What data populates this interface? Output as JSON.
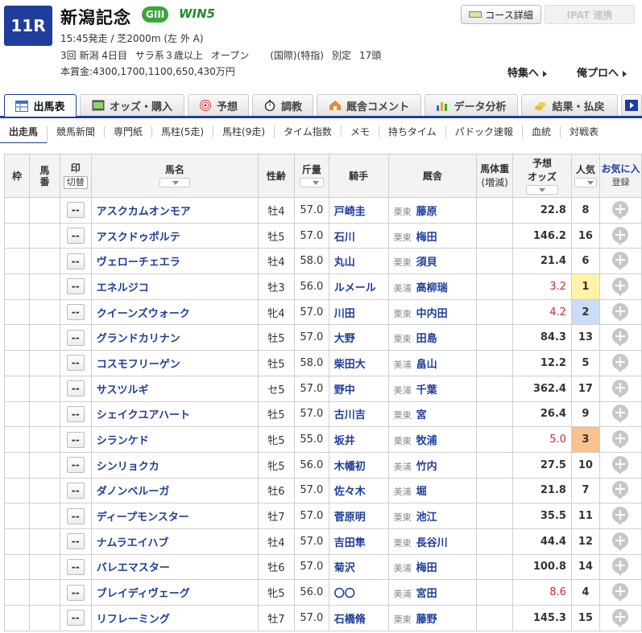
{
  "race": {
    "number": "11R",
    "name": "新潟記念",
    "grade": "GIII",
    "win5_label": "WIN5",
    "start_time": "15:45発走",
    "course": "芝2000m (左 外 A)",
    "info": [
      "3回 新潟 4日目",
      "サラ系３歳以上",
      "オープン",
      "(国際)(特指)",
      "別定",
      "17頭"
    ],
    "prize": "本賞金:4300,1700,1100,650,430万円"
  },
  "header_buttons": {
    "course_detail": "コース詳細",
    "ipat": "IPAT 連携",
    "feature": "特集へ",
    "pro": "俺プロへ"
  },
  "tabs": [
    {
      "label": "出馬表",
      "active": true
    },
    {
      "label": "オッズ・購入",
      "active": false
    },
    {
      "label": "予想",
      "active": false
    },
    {
      "label": "調教",
      "active": false
    },
    {
      "label": "厩舎コメント",
      "active": false
    },
    {
      "label": "データ分析",
      "active": false
    },
    {
      "label": "結果・払戻",
      "active": false
    }
  ],
  "subtabs": [
    "出走馬",
    "競馬新聞",
    "専門紙",
    "馬柱(5走)",
    "馬柱(9走)",
    "タイム指数",
    "メモ",
    "持ちタイム",
    "パドック速報",
    "血統",
    "対戦表"
  ],
  "columns": {
    "waku": "枠",
    "umaban": "馬番",
    "mark": "印",
    "mark_toggle": "切替",
    "horse": "馬名",
    "sexage": "性齢",
    "weight": "斤量",
    "jockey": "騎手",
    "trainer": "厩舎",
    "body_weight": "馬体重",
    "body_weight_sub": "(増減)",
    "odds": "予想",
    "odds_sub": "オッズ",
    "popularity": "人気",
    "fav": "お気に入",
    "fav_sub": "登録"
  },
  "mark_default": "--",
  "horses": [
    {
      "name": "アスクカムオンモア",
      "sexage": "牡4",
      "kg": "57.0",
      "jockey": "戸崎圭",
      "region": "栗東",
      "trainer": "藤原",
      "odds": "22.8",
      "pop": "8"
    },
    {
      "name": "アスクドゥポルテ",
      "sexage": "牡5",
      "kg": "57.0",
      "jockey": "石川",
      "region": "栗東",
      "trainer": "梅田",
      "odds": "146.2",
      "pop": "16"
    },
    {
      "name": "ヴェローチェエラ",
      "sexage": "牡4",
      "kg": "58.0",
      "jockey": "丸山",
      "region": "栗東",
      "trainer": "須貝",
      "odds": "21.4",
      "pop": "6"
    },
    {
      "name": "エネルジコ",
      "sexage": "牡3",
      "kg": "56.0",
      "jockey": "ルメール",
      "region": "美浦",
      "trainer": "高柳瑞",
      "odds": "3.2",
      "pop": "1"
    },
    {
      "name": "クイーンズウォーク",
      "sexage": "牝4",
      "kg": "57.0",
      "jockey": "川田",
      "region": "栗東",
      "trainer": "中内田",
      "odds": "4.2",
      "pop": "2"
    },
    {
      "name": "グランドカリナン",
      "sexage": "牡5",
      "kg": "57.0",
      "jockey": "大野",
      "region": "栗東",
      "trainer": "田島",
      "odds": "84.3",
      "pop": "13"
    },
    {
      "name": "コスモフリーゲン",
      "sexage": "牡5",
      "kg": "58.0",
      "jockey": "柴田大",
      "region": "美浦",
      "trainer": "畠山",
      "odds": "12.2",
      "pop": "5"
    },
    {
      "name": "サスツルギ",
      "sexage": "セ5",
      "kg": "57.0",
      "jockey": "野中",
      "region": "美浦",
      "trainer": "千葉",
      "odds": "362.4",
      "pop": "17"
    },
    {
      "name": "シェイクユアハート",
      "sexage": "牡5",
      "kg": "57.0",
      "jockey": "古川吉",
      "region": "栗東",
      "trainer": "宮",
      "odds": "26.4",
      "pop": "9"
    },
    {
      "name": "シランケド",
      "sexage": "牝5",
      "kg": "55.0",
      "jockey": "坂井",
      "region": "栗東",
      "trainer": "牧浦",
      "odds": "5.0",
      "pop": "3"
    },
    {
      "name": "シンリョクカ",
      "sexage": "牝5",
      "kg": "56.0",
      "jockey": "木幡初",
      "region": "美浦",
      "trainer": "竹内",
      "odds": "27.5",
      "pop": "10"
    },
    {
      "name": "ダノンベルーガ",
      "sexage": "牡6",
      "kg": "57.0",
      "jockey": "佐々木",
      "region": "美浦",
      "trainer": "堀",
      "odds": "21.8",
      "pop": "7"
    },
    {
      "name": "ディープモンスター",
      "sexage": "牡7",
      "kg": "57.0",
      "jockey": "菅原明",
      "region": "栗東",
      "trainer": "池江",
      "odds": "35.5",
      "pop": "11"
    },
    {
      "name": "ナムラエイハブ",
      "sexage": "牡4",
      "kg": "57.0",
      "jockey": "吉田隼",
      "region": "栗東",
      "trainer": "長谷川",
      "odds": "44.4",
      "pop": "12"
    },
    {
      "name": "バレエマスター",
      "sexage": "牡6",
      "kg": "57.0",
      "jockey": "菊沢",
      "region": "美浦",
      "trainer": "梅田",
      "odds": "100.8",
      "pop": "14"
    },
    {
      "name": "ブレイディヴェーグ",
      "sexage": "牝5",
      "kg": "56.0",
      "jockey": "〇〇",
      "region": "美浦",
      "trainer": "宮田",
      "odds": "8.6",
      "pop": "4"
    },
    {
      "name": "リフレーミング",
      "sexage": "牡7",
      "kg": "57.0",
      "jockey": "石橋脩",
      "region": "栗東",
      "trainer": "藤野",
      "odds": "145.3",
      "pop": "15"
    }
  ],
  "colors": {
    "brand": "#1e3d9c",
    "grade_green": "#3aa637",
    "hot_odds": "#d12b2b",
    "pop1": "#fff3a8",
    "pop2": "#cbdcf7",
    "pop3": "#f6c28f"
  }
}
